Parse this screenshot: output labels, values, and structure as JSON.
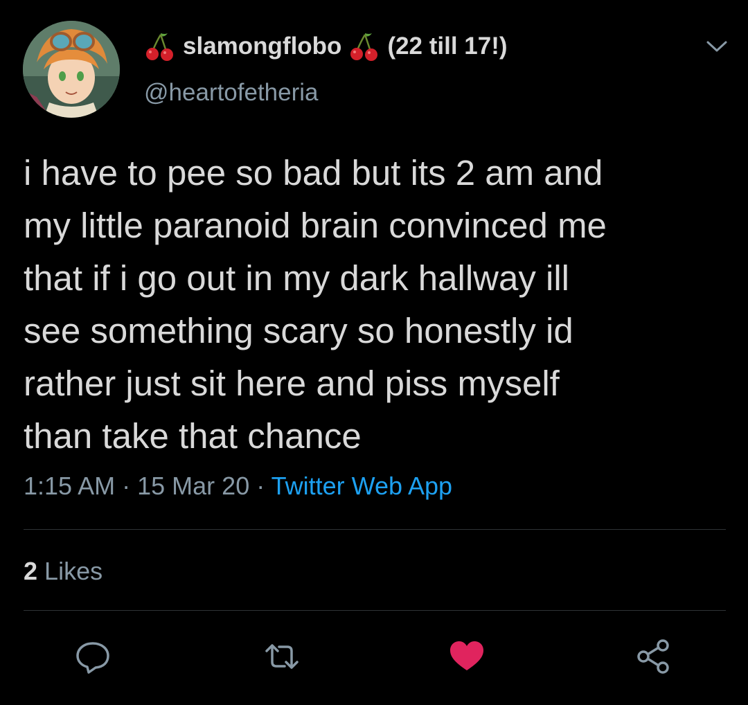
{
  "author": {
    "display_name": "slamongflobo",
    "name_suffix": "(22 till 17!)",
    "handle": "@heartofetheria",
    "name_emoji": "cherries-emoji"
  },
  "tweet": {
    "text": "i have to pee so bad but its 2 am and\nmy little paranoid brain convinced me\nthat if i go out in my dark hallway ill\nsee something scary so honestly id\nrather just sit here and piss myself\nthan take that chance",
    "time": "1:15 AM",
    "date": "15 Mar 20",
    "separator": "·",
    "source": "Twitter Web App"
  },
  "stats": {
    "likes_count": "2",
    "likes_label": "Likes"
  },
  "actions": {
    "reply_icon": "reply-icon",
    "retweet_icon": "retweet-icon",
    "like_icon": "heart-icon",
    "share_icon": "share-icon",
    "menu_icon": "chevron-down-icon"
  },
  "colors": {
    "background": "#000000",
    "text": "#d9d9d9",
    "secondary": "#8899a6",
    "link": "#1da1f2",
    "liked": "#e0245e",
    "divider": "#2f3336"
  }
}
